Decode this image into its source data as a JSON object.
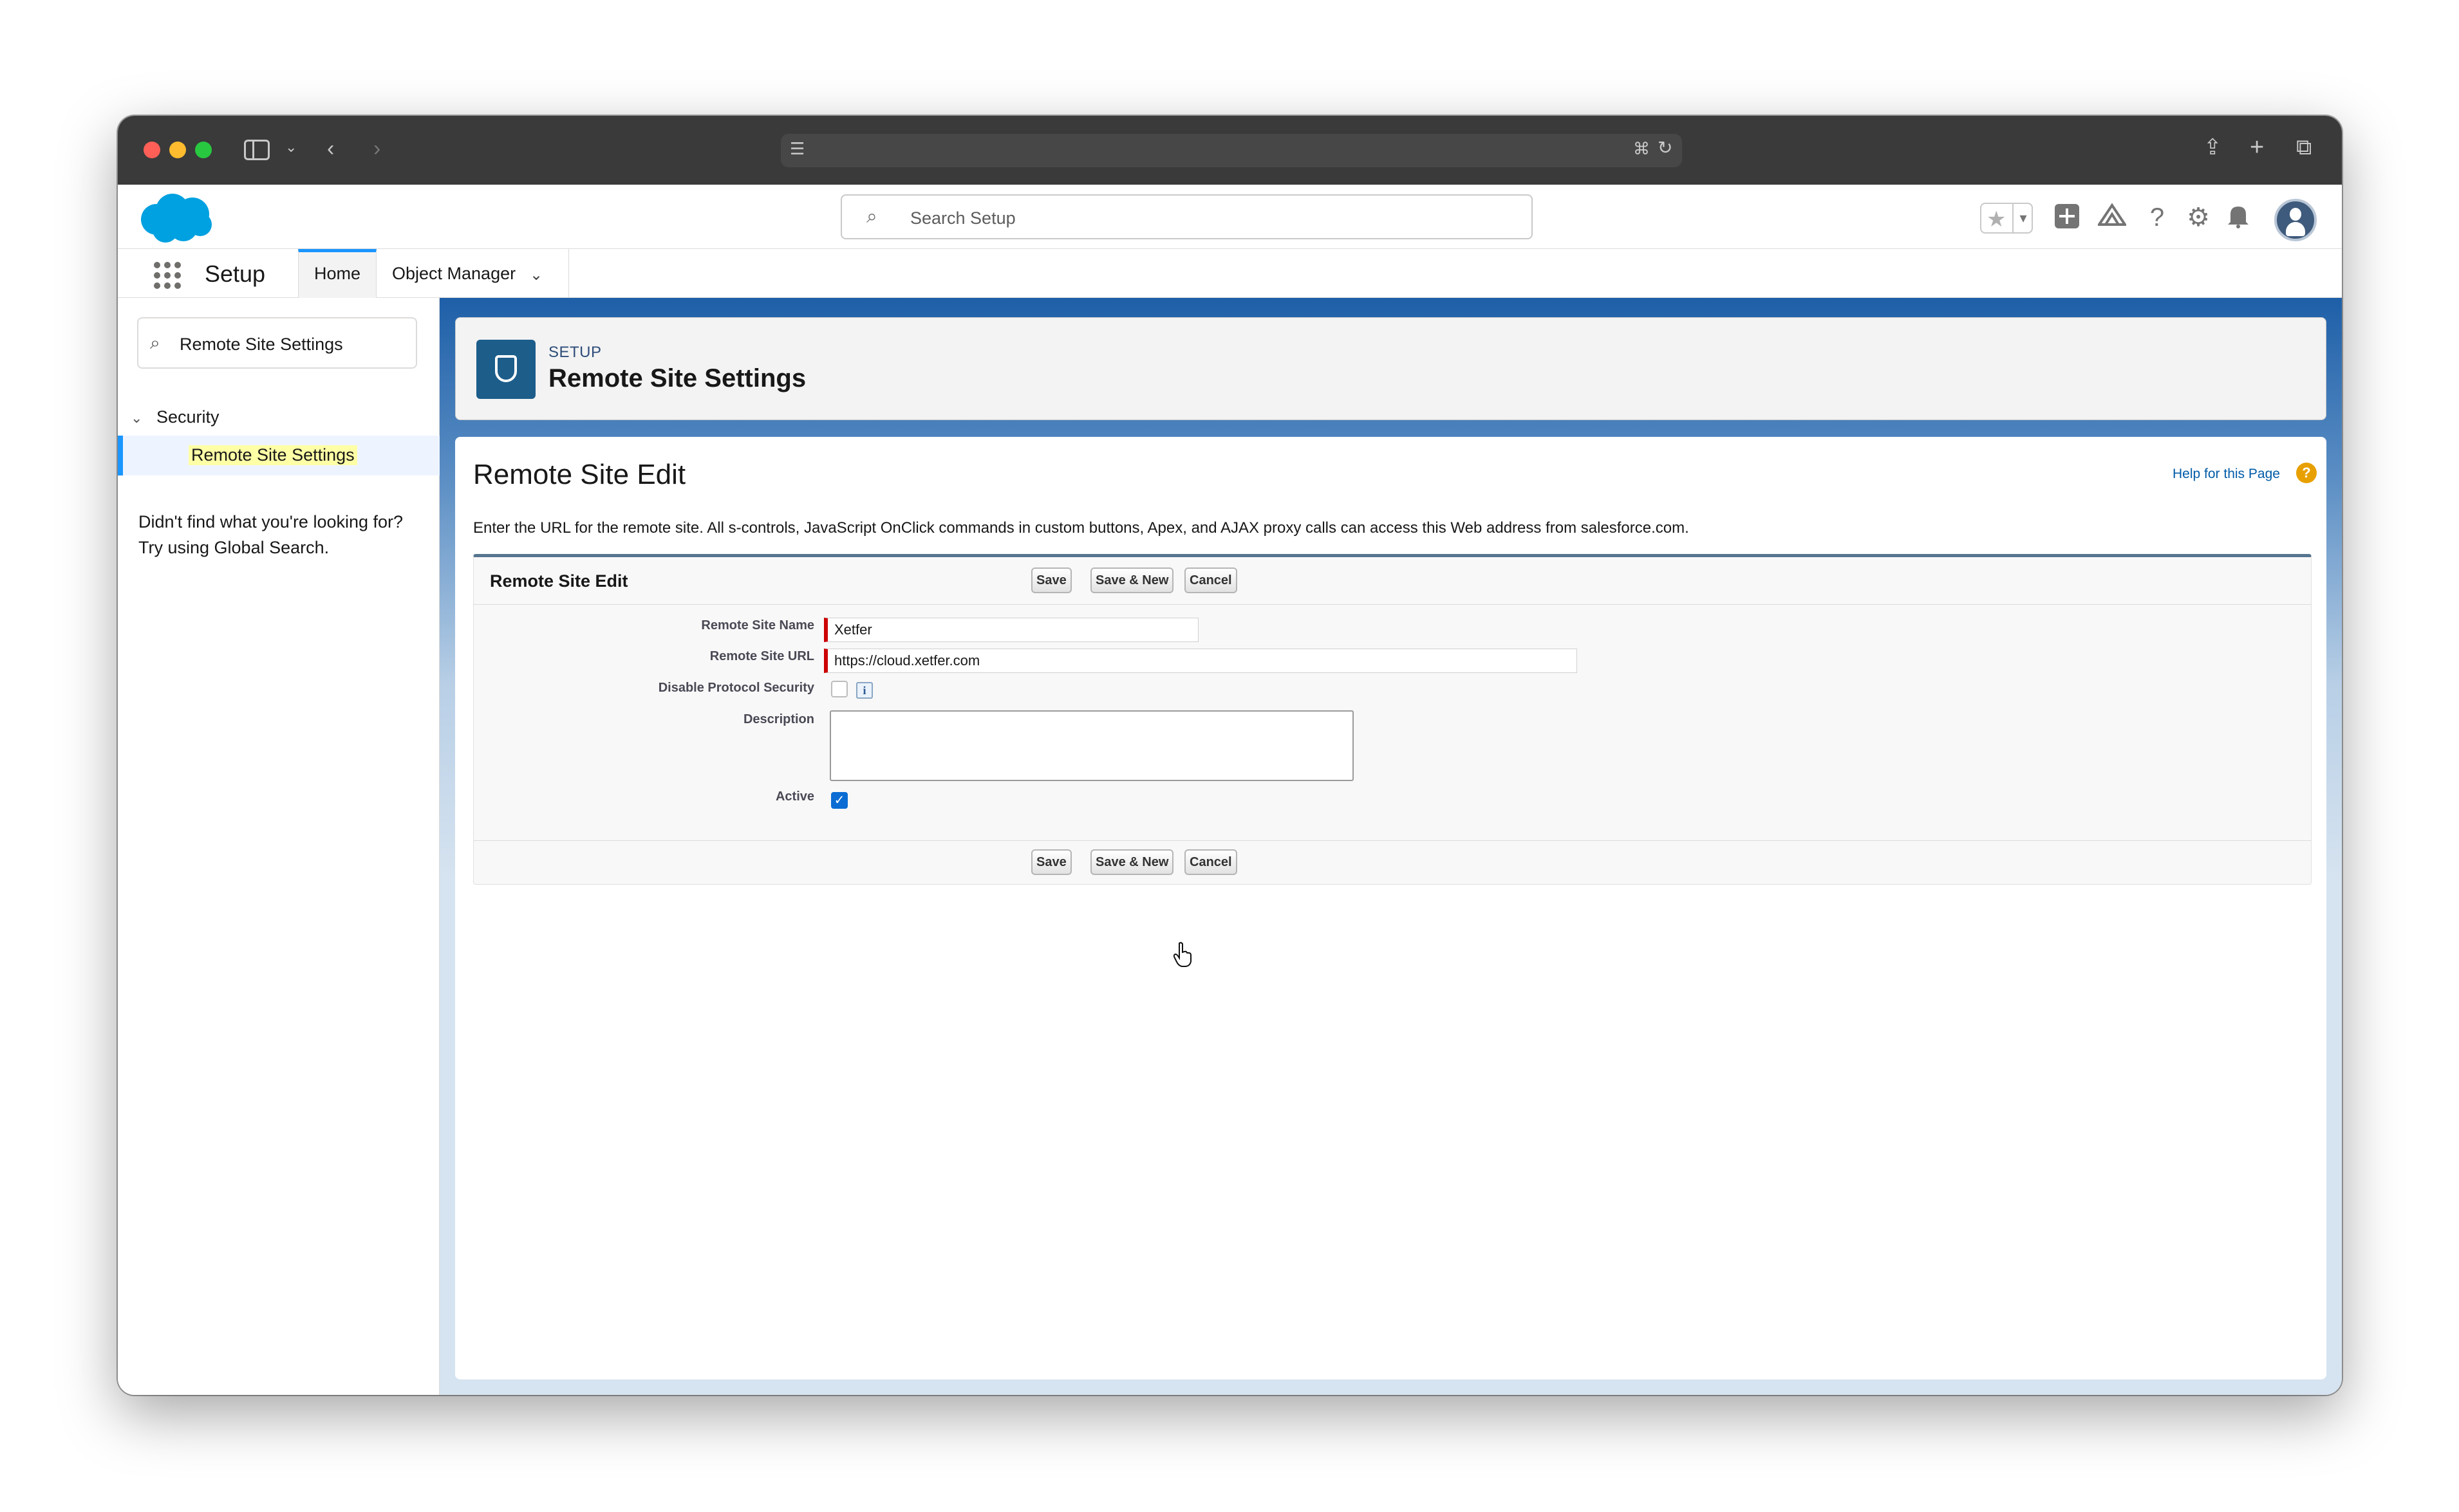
{
  "browser": {
    "address": ""
  },
  "header": {
    "search_placeholder": "Search Setup"
  },
  "app_nav": {
    "app_name": "Setup",
    "tabs": [
      {
        "label": "Home",
        "active": true
      },
      {
        "label": "Object Manager",
        "active": false
      }
    ]
  },
  "sidebar": {
    "quick_find_value": "Remote Site Settings",
    "tree_group": "Security",
    "tree_item": "Remote Site Settings",
    "not_found_line1": "Didn't find what you're looking for?",
    "not_found_line2": "Try using Global Search."
  },
  "page_header": {
    "eyebrow": "SETUP",
    "title": "Remote Site Settings"
  },
  "content": {
    "title": "Remote Site Edit",
    "help_link": "Help for this Page",
    "help_badge": "?",
    "description": "Enter the URL for the remote site. All s-controls, JavaScript OnClick commands in custom buttons, Apex, and AJAX proxy calls can access this Web address from salesforce.com."
  },
  "edit_block": {
    "title": "Remote Site Edit",
    "buttons": {
      "save": "Save",
      "save_new": "Save & New",
      "cancel": "Cancel"
    },
    "fields": {
      "name_label": "Remote Site Name",
      "name_value": "Xetfer",
      "url_label": "Remote Site URL",
      "url_value": "https://cloud.xetfer.com",
      "disable_label": "Disable Protocol Security",
      "disable_checked": false,
      "info_icon": "i",
      "description_label": "Description",
      "description_value": "",
      "active_label": "Active",
      "active_checked": true
    }
  },
  "colors": {
    "brand_blue": "#1b96ff",
    "required_red": "#cc0000",
    "header_band": "#1e5fa8"
  }
}
